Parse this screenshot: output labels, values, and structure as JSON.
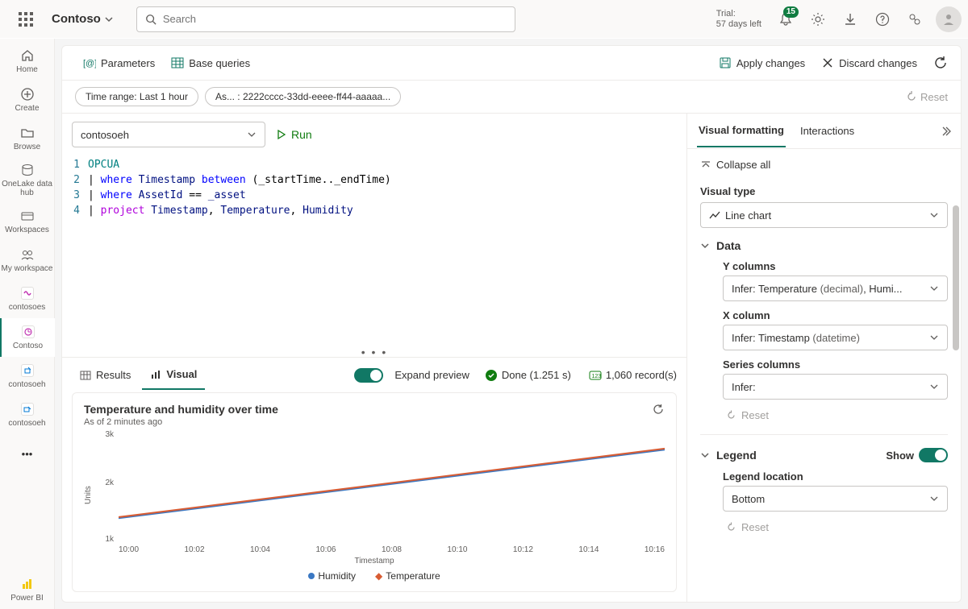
{
  "topbar": {
    "org": "Contoso",
    "search_placeholder": "Search",
    "trial_line1": "Trial:",
    "trial_line2": "57 days left",
    "badge_count": "15"
  },
  "leftrail": {
    "items": [
      {
        "label": "Home"
      },
      {
        "label": "Create"
      },
      {
        "label": "Browse"
      },
      {
        "label": "OneLake data hub"
      },
      {
        "label": "Workspaces"
      },
      {
        "label": "My workspace"
      },
      {
        "label": "contosoes"
      },
      {
        "label": "Contoso"
      },
      {
        "label": "contosoeh"
      },
      {
        "label": "contosoeh"
      }
    ],
    "powerbi": "Power BI"
  },
  "toolbar1": {
    "parameters": "Parameters",
    "base_queries": "Base queries",
    "apply": "Apply changes",
    "discard": "Discard changes"
  },
  "toolbar2": {
    "pill1": "Time range: Last 1 hour",
    "pill2": "As... : 2222cccc-33dd-eeee-ff44-aaaaa...",
    "reset": "Reset"
  },
  "dbselect": "contosoeh",
  "run_label": "Run",
  "code": {
    "line1": "OPCUA",
    "l2a": "where",
    "l2b": "Timestamp",
    "l2c": "between",
    "l2d": "(_startTime.._endTime)",
    "l3a": "where",
    "l3b": "AssetId",
    "l3c": "==",
    "l3d": "_asset",
    "l4a": "project",
    "l4b": "Timestamp",
    "l4c": "Temperature",
    "l4d": "Humidity"
  },
  "result_tabs": {
    "results": "Results",
    "visual": "Visual",
    "expand": "Expand preview",
    "done": "Done (1.251 s)",
    "records": "1,060 record(s)"
  },
  "chart": {
    "title": "Temperature and humidity over time",
    "subtitle": "As of 2 minutes ago",
    "ylabel": "Units",
    "xlabel": "Timestamp",
    "legend1": "Humidity",
    "legend2": "Temperature"
  },
  "chart_data": {
    "type": "line",
    "title": "Temperature and humidity over time",
    "xlabel": "Timestamp",
    "ylabel": "Units",
    "ylim": [
      1000,
      3000
    ],
    "x_ticks": [
      "10:00",
      "10:02",
      "10:04",
      "10:06",
      "10:08",
      "10:10",
      "10:12",
      "10:14",
      "10:16"
    ],
    "y_ticks": [
      "1k",
      "2k",
      "3k"
    ],
    "series": [
      {
        "name": "Humidity",
        "color": "#3a78c3",
        "values": [
          1700,
          1820,
          1940,
          2060,
          2180,
          2300,
          2420,
          2540,
          2660
        ]
      },
      {
        "name": "Temperature",
        "color": "#d85c33",
        "values": [
          1710,
          1830,
          1950,
          2070,
          2190,
          2310,
          2430,
          2550,
          2670
        ]
      }
    ]
  },
  "rightpane": {
    "tab1": "Visual formatting",
    "tab2": "Interactions",
    "collapse": "Collapse all",
    "visual_type_lbl": "Visual type",
    "visual_type_val": "Line chart",
    "data_lbl": "Data",
    "ycol_lbl": "Y columns",
    "ycol_val": "Infer: Temperature (decimal), Humi...",
    "xcol_lbl": "X column",
    "xcol_val": "Infer: Timestamp (datetime)",
    "series_lbl": "Series columns",
    "series_val": "Infer:",
    "reset": "Reset",
    "legend_lbl": "Legend",
    "show": "Show",
    "loc_lbl": "Legend location",
    "loc_val": "Bottom"
  }
}
